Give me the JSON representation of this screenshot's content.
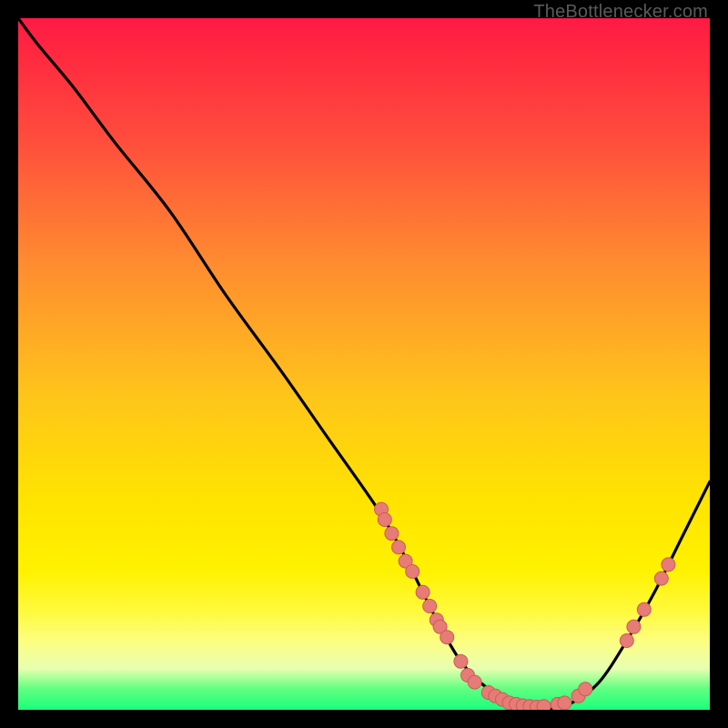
{
  "attribution": "TheBottlenecker.com",
  "colors": {
    "frame": "#000000",
    "curve": "#000000",
    "marker_fill": "#e77b76",
    "marker_stroke": "#c95c57",
    "gradient_top": "#ff1a44",
    "gradient_bottom": "#19ff7a"
  },
  "chart_data": {
    "type": "line",
    "title": "",
    "xlabel": "",
    "ylabel": "",
    "xlim": [
      0,
      100
    ],
    "ylim": [
      0,
      100
    ],
    "x": [
      0,
      3,
      8,
      14,
      22,
      30,
      38,
      45,
      52,
      56,
      60,
      64,
      68,
      72,
      76,
      80,
      84,
      88,
      92,
      96,
      100
    ],
    "y": [
      100,
      96,
      90,
      82,
      72,
      60,
      49,
      39,
      29,
      22,
      14,
      7,
      3,
      1,
      0,
      1,
      4,
      10,
      17,
      25,
      33
    ],
    "markers": [
      {
        "x": 52.5,
        "y": 29.0
      },
      {
        "x": 53.0,
        "y": 27.5
      },
      {
        "x": 54.0,
        "y": 25.5
      },
      {
        "x": 55.0,
        "y": 23.5
      },
      {
        "x": 56.0,
        "y": 21.5
      },
      {
        "x": 57.0,
        "y": 20.0
      },
      {
        "x": 58.5,
        "y": 17.0
      },
      {
        "x": 59.5,
        "y": 15.0
      },
      {
        "x": 60.5,
        "y": 13.0
      },
      {
        "x": 61.0,
        "y": 12.0
      },
      {
        "x": 62.0,
        "y": 10.5
      },
      {
        "x": 64.0,
        "y": 7.0
      },
      {
        "x": 65.0,
        "y": 5.0
      },
      {
        "x": 66.0,
        "y": 4.0
      },
      {
        "x": 68.0,
        "y": 2.5
      },
      {
        "x": 69.0,
        "y": 2.0
      },
      {
        "x": 70.0,
        "y": 1.5
      },
      {
        "x": 71.0,
        "y": 1.0
      },
      {
        "x": 72.0,
        "y": 0.8
      },
      {
        "x": 73.0,
        "y": 0.6
      },
      {
        "x": 74.0,
        "y": 0.5
      },
      {
        "x": 75.0,
        "y": 0.4
      },
      {
        "x": 76.0,
        "y": 0.5
      },
      {
        "x": 78.0,
        "y": 0.8
      },
      {
        "x": 79.0,
        "y": 1.0
      },
      {
        "x": 81.0,
        "y": 2.0
      },
      {
        "x": 82.0,
        "y": 3.0
      },
      {
        "x": 88.0,
        "y": 10.0
      },
      {
        "x": 89.0,
        "y": 12.0
      },
      {
        "x": 90.5,
        "y": 14.5
      },
      {
        "x": 93.0,
        "y": 19.0
      },
      {
        "x": 94.0,
        "y": 21.0
      }
    ]
  }
}
